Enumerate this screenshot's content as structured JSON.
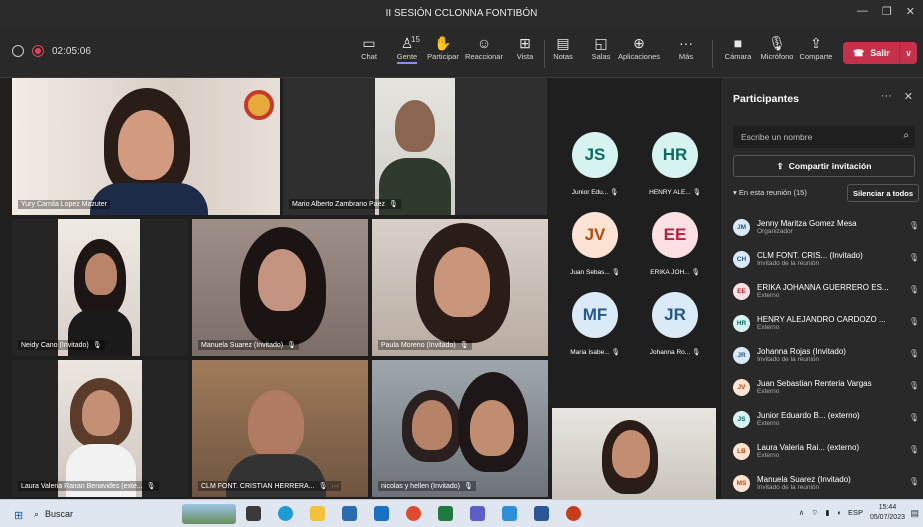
{
  "window": {
    "title": "II SESIÓN CCLONNA FONTIBÓN"
  },
  "toolbar": {
    "timer": "02:05:06",
    "buttons": [
      {
        "label": "Chat",
        "icon": "chat-icon"
      },
      {
        "label": "Gente",
        "icon": "people-icon",
        "count": "15"
      },
      {
        "label": "Participar",
        "icon": "raise-hand-icon"
      },
      {
        "label": "Reaccionar",
        "icon": "smiley-icon"
      },
      {
        "label": "Vista",
        "icon": "grid-view-icon"
      },
      {
        "label": "Notas",
        "icon": "notes-icon"
      },
      {
        "label": "Salas",
        "icon": "rooms-icon"
      },
      {
        "label": "Aplicaciones",
        "icon": "apps-icon"
      },
      {
        "label": "Más",
        "icon": "more-icon"
      },
      {
        "label": "Cámara",
        "icon": "camera-icon"
      },
      {
        "label": "Micrófono",
        "icon": "mic-off-icon"
      },
      {
        "label": "Comparte",
        "icon": "share-icon"
      }
    ],
    "leave_label": "Salir"
  },
  "tiles": [
    {
      "name": "Yury Camila Lopez Mazuter"
    },
    {
      "name": "Mario Alberto Zambrano Paez"
    },
    {
      "name": "Neidy Cano (Invitado)"
    },
    {
      "name": "Manuela Suarez (Invitado)"
    },
    {
      "name": "Paula Moreno (Invitado)"
    },
    {
      "name": "Laura Valeria Rairan Benavides (exte..."
    },
    {
      "name": "CLM FONT. CRISTIAN HERRERA..."
    },
    {
      "name": "nicolas y hellen (Invitado)"
    }
  ],
  "avatars": [
    {
      "initials": "JS",
      "name": "Junior Edu...",
      "bg": "#d7f3ef",
      "fg": "#0a6b61"
    },
    {
      "initials": "HR",
      "name": "HENRY ALE...",
      "bg": "#d7f3ef",
      "fg": "#0a6b61"
    },
    {
      "initials": "JV",
      "name": "Juan Sebas...",
      "bg": "#fde3d3",
      "fg": "#b24a12"
    },
    {
      "initials": "EE",
      "name": "ERIKA JOH...",
      "bg": "#fde0e4",
      "fg": "#b2243d"
    },
    {
      "initials": "MF",
      "name": "Maria Isabe...",
      "bg": "#dbeaf7",
      "fg": "#27588a"
    },
    {
      "initials": "JR",
      "name": "Johanna Ro...",
      "bg": "#dbeaf7",
      "fg": "#27588a"
    }
  ],
  "panel": {
    "title": "Participantes",
    "search_placeholder": "Escribe un nombre",
    "share_label": "Compartir invitación",
    "in_meeting": "En esta reunión (15)",
    "mute_all": "Silenciar a todos",
    "participants": [
      {
        "initials": "JM",
        "name": "Jenny Maritza Gomez Mesa",
        "role": "Organizador",
        "bg": "#dbeaf7",
        "fg": "#27588a"
      },
      {
        "initials": "CH",
        "name": "CLM FONT. CRIS... (Invitado)",
        "role": "Invitado de la reunión",
        "bg": "#dbeaf7",
        "fg": "#27588a"
      },
      {
        "initials": "EE",
        "name": "ERIKA JOHANNA GUERRERO ES...",
        "role": "Externo",
        "bg": "#fde0e4",
        "fg": "#b2243d"
      },
      {
        "initials": "HR",
        "name": "HENRY ALEJANDRO CARDOZO ...",
        "role": "Externo",
        "bg": "#d7f3ef",
        "fg": "#0a6b61"
      },
      {
        "initials": "JR",
        "name": "Johanna Rojas (Invitado)",
        "role": "Invitado de la reunión",
        "bg": "#dbeaf7",
        "fg": "#27588a"
      },
      {
        "initials": "JV",
        "name": "Juan Sebastian Renteria Vargas",
        "role": "Externo",
        "bg": "#fde3d3",
        "fg": "#b24a12"
      },
      {
        "initials": "JS",
        "name": "Junior Eduardo B... (externo)",
        "role": "Externo",
        "bg": "#d7f3ef",
        "fg": "#0a6b61"
      },
      {
        "initials": "LB",
        "name": "Laura Valeria Rai... (externo)",
        "role": "Externo",
        "bg": "#fde3d3",
        "fg": "#b24a12"
      },
      {
        "initials": "MS",
        "name": "Manuela Suarez (Invitado)",
        "role": "Invitado de la reunión",
        "bg": "#fde3d3",
        "fg": "#b24a12"
      }
    ]
  },
  "taskbar": {
    "search_label": "Buscar",
    "language": "ESP",
    "time": "15:44",
    "date": "05/07/2023"
  }
}
